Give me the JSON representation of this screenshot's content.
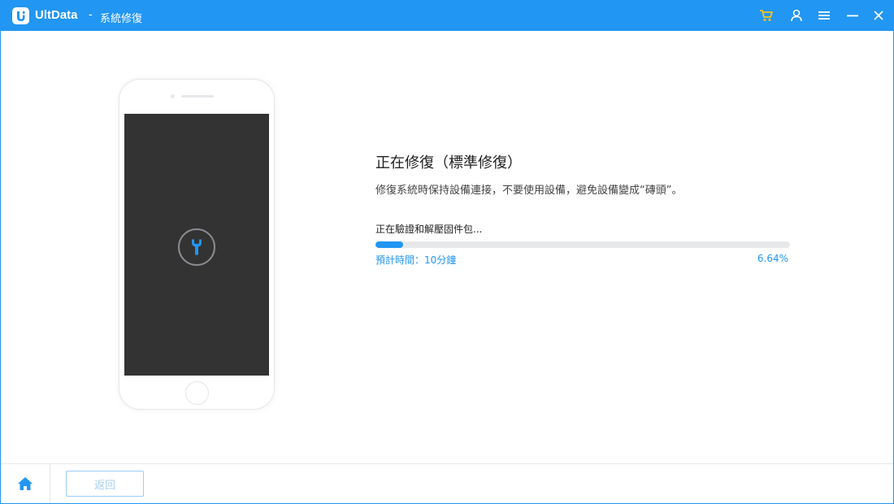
{
  "titlebar": {
    "app_name": "UltData",
    "separator": "-",
    "section": "系統修復",
    "icons": [
      "logo-icon",
      "cart-icon",
      "user-icon",
      "menu-icon",
      "minimize-icon",
      "close-icon"
    ]
  },
  "main": {
    "title": "正在修復（標準修復）",
    "description": "修復系統時保持設備連接，不要使用設備，避免設備變成“磚頭”。",
    "progress": {
      "label": "正在驗證和解壓固件包...",
      "eta": "預計時間：10分鐘",
      "percent_text": "6.64%",
      "value": 6.64
    }
  },
  "footer": {
    "back_label": "返回"
  },
  "colors": {
    "brand": "#2196f3",
    "cart": "#f5c518",
    "screen": "#333334",
    "track": "#e7e8ea"
  }
}
